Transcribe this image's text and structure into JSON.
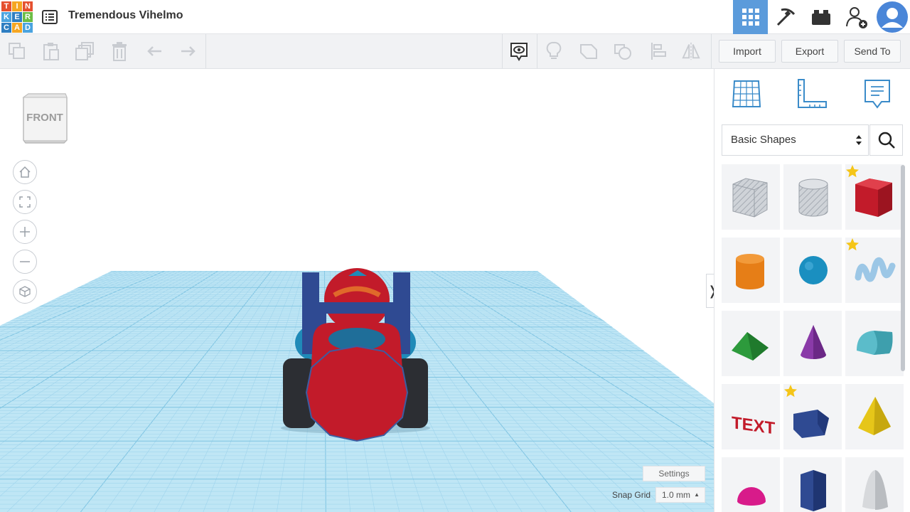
{
  "app": {
    "logo_letters": [
      "T",
      "I",
      "N",
      "K",
      "E",
      "R",
      "C",
      "A",
      "D"
    ],
    "document_title": "Tremendous Vihelmo"
  },
  "header": {
    "icons": [
      "3d-design-grid-icon",
      "pickaxe-icon",
      "bricks-icon",
      "invite-user-icon",
      "avatar-icon"
    ],
    "active": "3d-design-grid-icon"
  },
  "toolbar": {
    "left_tools": [
      "copy-icon",
      "paste-icon",
      "duplicate-icon",
      "delete-icon",
      "undo-icon",
      "redo-icon"
    ],
    "right_tools": [
      "notes-toggle-icon",
      "lightbulb-icon",
      "group-icon",
      "ungroup-icon",
      "align-icon",
      "mirror-icon"
    ],
    "import_label": "Import",
    "export_label": "Export",
    "send_to_label": "Send To"
  },
  "workplane": {
    "view_cube_label": "FRONT",
    "nav_buttons": [
      "home-view-icon",
      "fit-view-icon",
      "zoom-in-icon",
      "zoom-out-icon",
      "orthographic-icon"
    ],
    "settings_label": "Settings",
    "snap_grid_label": "Snap Grid",
    "snap_grid_value": "1.0 mm"
  },
  "panel": {
    "tabs": [
      "workplane-tool-icon",
      "ruler-tool-icon",
      "notes-tool-icon"
    ],
    "shape_category": "Basic Shapes",
    "shapes": [
      {
        "name": "box-hole",
        "starred": false
      },
      {
        "name": "cylinder-hole",
        "starred": false
      },
      {
        "name": "box",
        "starred": true
      },
      {
        "name": "cylinder",
        "starred": false
      },
      {
        "name": "sphere",
        "starred": false
      },
      {
        "name": "scribble",
        "starred": true
      },
      {
        "name": "roof",
        "starred": false
      },
      {
        "name": "cone",
        "starred": false
      },
      {
        "name": "round-roof",
        "starred": false
      },
      {
        "name": "text",
        "starred": false
      },
      {
        "name": "polygon",
        "starred": true
      },
      {
        "name": "pyramid",
        "starred": false
      },
      {
        "name": "half-sphere",
        "starred": false
      },
      {
        "name": "hexagonal-prism",
        "starred": false
      },
      {
        "name": "paraboloid",
        "starred": false
      }
    ]
  },
  "colors": {
    "accent_blue": "#5b9bdb",
    "grid_blue": "#a9d8ee",
    "model_red": "#c21b2a",
    "model_navy": "#2f4a92",
    "model_teal": "#1f8ab8",
    "star_yellow": "#f5c518"
  }
}
